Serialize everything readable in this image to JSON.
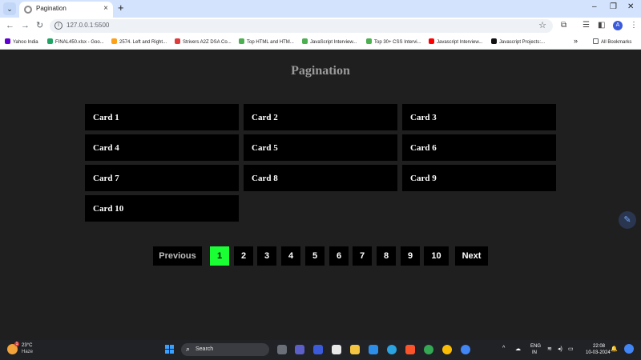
{
  "browser": {
    "tab_title": "Pagination",
    "new_tab": "+",
    "url": "127.0.0.1:5500",
    "profile_initial": "A",
    "bookmarks": [
      {
        "label": "Yahoo India",
        "color": "#6001d2"
      },
      {
        "label": "FINAL450.xlsx - Goo...",
        "color": "#1fa463"
      },
      {
        "label": "2574. Left and Right...",
        "color": "#ffa116"
      },
      {
        "label": "Strivers A2Z DSA Co...",
        "color": "#e03a3a"
      },
      {
        "label": "Top HTML and HTM...",
        "color": "#4caf50"
      },
      {
        "label": "JavaScript Interview...",
        "color": "#4caf50"
      },
      {
        "label": "Top 30+ CSS Intervi...",
        "color": "#4caf50"
      },
      {
        "label": "Javascript Interview...",
        "color": "#ff0000"
      },
      {
        "label": "Javascript Projects:...",
        "color": "#111111"
      }
    ],
    "more_bookmarks": "»",
    "all_bookmarks": "All Bookmarks"
  },
  "page": {
    "title": "Pagination",
    "cards": [
      "Card 1",
      "Card 2",
      "Card 3",
      "Card 4",
      "Card 5",
      "Card 6",
      "Card 7",
      "Card 8",
      "Card 9",
      "Card 10"
    ],
    "pagination": {
      "previous": "Previous",
      "next": "Next",
      "pages": [
        "1",
        "2",
        "3",
        "4",
        "5",
        "6",
        "7",
        "8",
        "9",
        "10"
      ],
      "active_page": "1"
    },
    "colors": {
      "background": "#1f1f1f",
      "card": "#000000",
      "active_page": "#19ff33"
    }
  },
  "taskbar": {
    "weather_badge": "1",
    "temperature": "23°C",
    "condition": "Haze",
    "search_placeholder": "Search",
    "language": "ENG",
    "region": "IN",
    "time": "22:08",
    "date": "10-03-2024"
  }
}
